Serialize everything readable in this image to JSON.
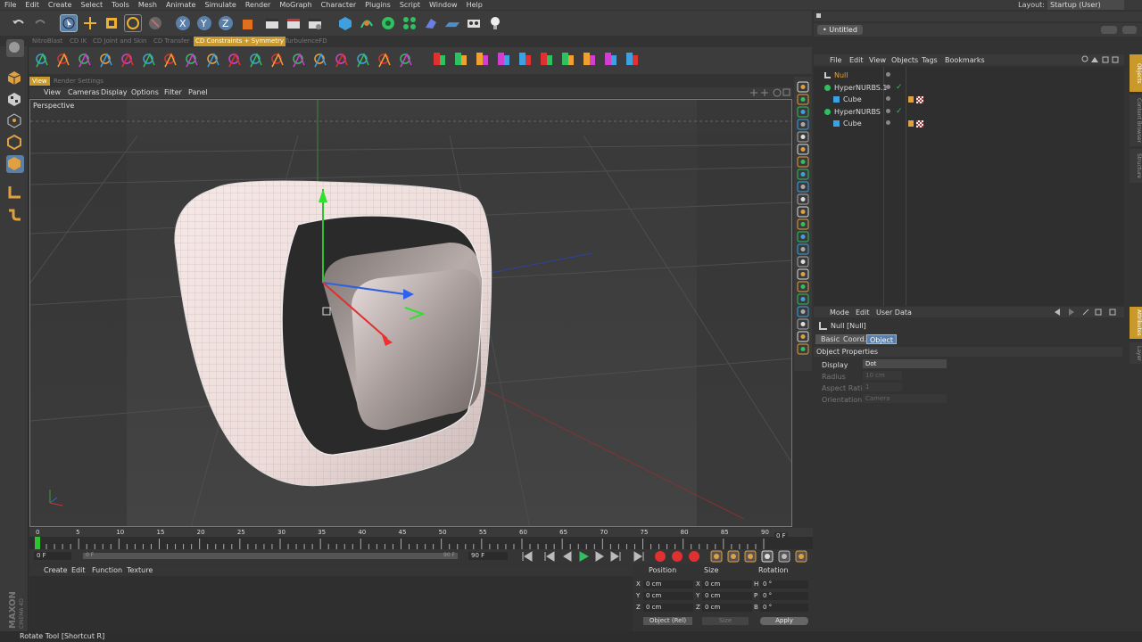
{
  "menubar": {
    "items": [
      "File",
      "Edit",
      "Create",
      "Select",
      "Tools",
      "Mesh",
      "Animate",
      "Simulate",
      "Render",
      "MoGraph",
      "Character",
      "Plugins",
      "Script",
      "Window",
      "Help"
    ],
    "layout_label": "Layout:",
    "layout_value": "Startup (User)"
  },
  "plugin_tabs": [
    {
      "label": "NitroBlast",
      "active": false
    },
    {
      "label": "CD IK",
      "active": false
    },
    {
      "label": "CD Joint and Skin",
      "active": false
    },
    {
      "label": "CD Transfer",
      "active": false
    },
    {
      "label": "CD Constraints + Symmetry",
      "active": true
    },
    {
      "label": "TurbulenceFD",
      "active": false
    }
  ],
  "view_tabs": {
    "view": "View",
    "render_settings": "Render Settings"
  },
  "view_menu": [
    "View",
    "Cameras",
    "Display",
    "Options",
    "Filter",
    "Panel"
  ],
  "viewport": {
    "camera_label": "Perspective"
  },
  "timeline": {
    "ticks": [
      "0",
      "5",
      "10",
      "15",
      "20",
      "25",
      "30",
      "35",
      "40",
      "45",
      "50",
      "55",
      "60",
      "65",
      "70",
      "75",
      "80",
      "85",
      "90"
    ],
    "end_frame_label": "0 F",
    "current_frame": "0 F",
    "start_field": "0 F",
    "end_field": "90 F",
    "end_field2": "90 F"
  },
  "material_menu": [
    "Create",
    "Edit",
    "Function",
    "Texture"
  ],
  "coordinates": {
    "headers": {
      "position": "Position",
      "size": "Size",
      "rotation": "Rotation"
    },
    "rows": [
      {
        "axis": "X",
        "pos": "0 cm",
        "size_axis": "X",
        "size": "0 cm",
        "rot_axis": "H",
        "rot": "0 °"
      },
      {
        "axis": "Y",
        "pos": "0 cm",
        "size_axis": "Y",
        "size": "0 cm",
        "rot_axis": "P",
        "rot": "0 °"
      },
      {
        "axis": "Z",
        "pos": "0 cm",
        "size_axis": "Z",
        "size": "0 cm",
        "rot_axis": "B",
        "rot": "0 °"
      }
    ],
    "mode_select": "Object (Rel)",
    "size_select": "Size",
    "apply_label": "Apply"
  },
  "status": "Rotate Tool [Shortcut R]",
  "maxon": {
    "line1": "MAXON",
    "line2": "CINEMA 4D"
  },
  "object_manager": {
    "doc_tab": "Untitled",
    "menu": [
      "File",
      "Edit",
      "View",
      "Objects",
      "Tags",
      "Bookmarks"
    ],
    "objects": [
      {
        "name": "Null",
        "indent": 0,
        "selected": true,
        "check": false,
        "tags": false
      },
      {
        "name": "HyperNURBS.1",
        "indent": 0,
        "selected": false,
        "check": true,
        "tags": false
      },
      {
        "name": "Cube",
        "indent": 1,
        "selected": false,
        "check": false,
        "tags": true
      },
      {
        "name": "HyperNURBS",
        "indent": 0,
        "selected": false,
        "check": true,
        "tags": false
      },
      {
        "name": "Cube",
        "indent": 1,
        "selected": false,
        "check": false,
        "tags": true
      }
    ],
    "side_tabs": [
      "Objects",
      "Content Browser",
      "Structure"
    ]
  },
  "attributes": {
    "menu": [
      "Mode",
      "Edit",
      "User Data"
    ],
    "object_title": "Null [Null]",
    "tabs": [
      {
        "label": "Basic",
        "active": false
      },
      {
        "label": "Coord.",
        "active": false
      },
      {
        "label": "Object",
        "active": true
      }
    ],
    "section": "Object Properties",
    "fields": [
      {
        "label": "Display",
        "value": "Dot",
        "enabled": true
      },
      {
        "label": "Radius",
        "value": "10 cm",
        "enabled": false
      },
      {
        "label": "Aspect Ratio",
        "value": "1",
        "enabled": false
      },
      {
        "label": "Orientation",
        "value": "Camera",
        "enabled": false
      }
    ],
    "side_tabs": [
      "Attributes",
      "Layer"
    ]
  },
  "colors": {
    "accent": "#c99a2b",
    "axis_x": "#e03030",
    "axis_y": "#30c030",
    "axis_z": "#3060e0",
    "selection_orange": "#f0a030"
  }
}
